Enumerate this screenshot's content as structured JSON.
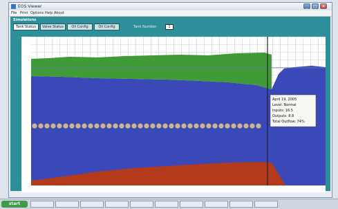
{
  "window": {
    "title": "EOS Viewer",
    "buttons": [
      "_",
      "□",
      "✕"
    ]
  },
  "menu": [
    "File",
    "Print",
    "Options",
    "Help",
    "About"
  ],
  "panel": {
    "title": "Simulations",
    "tabs": [
      "Tank Status",
      "Valve Status",
      "Oil Config",
      "Oil Config"
    ],
    "selector_label": "Tank Number:",
    "selector_value": "1"
  },
  "tooltip": {
    "lines": [
      "April 19, 2005",
      "Level: Normal",
      "Inputs: 16.5",
      "Outputs: 8.8",
      "Total Outflow: 74%"
    ]
  },
  "taskbar": {
    "start_label": "start",
    "items": [
      "",
      "",
      "",
      "",
      "",
      "",
      "",
      "",
      "",
      ""
    ],
    "clock": ""
  },
  "colors": {
    "green_layer": "#3f9a37",
    "blue_layer": "#3b48b8",
    "red_layer": "#b33a1c",
    "marker_line": "#222222",
    "dots": "#c9b79a"
  }
}
